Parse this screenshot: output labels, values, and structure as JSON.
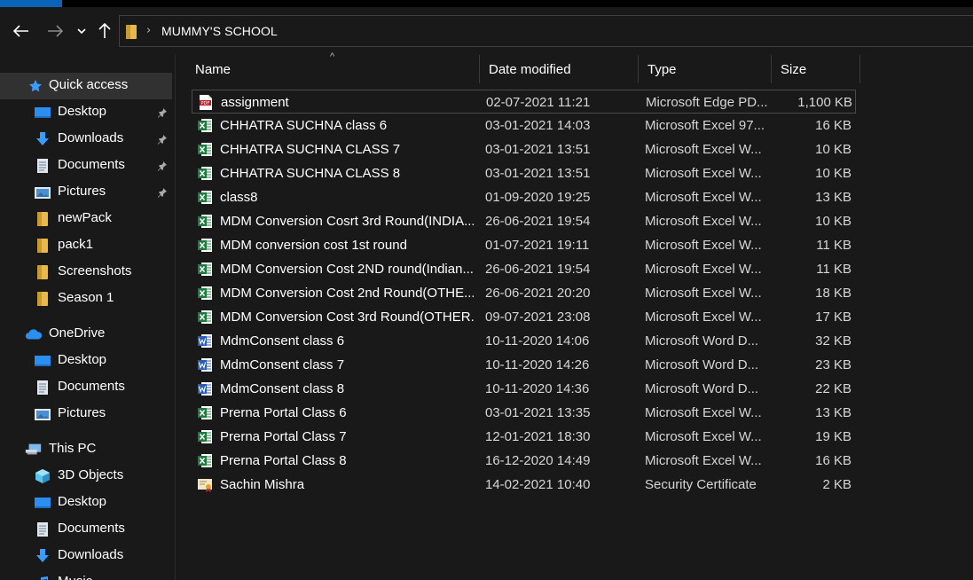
{
  "address": {
    "crumbs": [
      "MUMMY'S SCHOOL"
    ]
  },
  "nav": {
    "back_icon": "arrow-left-icon",
    "forward_icon": "arrow-right-icon",
    "recent_icon": "chevron-down-icon",
    "up_icon": "arrow-up-icon"
  },
  "sidebar": {
    "items": [
      {
        "label": "Quick access",
        "icon": "star-icon",
        "pinned": false,
        "selected": true
      },
      {
        "label": "Desktop",
        "icon": "desktop-icon",
        "pinned": true
      },
      {
        "label": "Downloads",
        "icon": "download-icon",
        "pinned": true
      },
      {
        "label": "Documents",
        "icon": "documents-icon",
        "pinned": true
      },
      {
        "label": "Pictures",
        "icon": "pictures-icon",
        "pinned": true
      },
      {
        "label": "newPack",
        "icon": "folder-icon",
        "pinned": false
      },
      {
        "label": "pack1",
        "icon": "folder-icon",
        "pinned": false
      },
      {
        "label": "Screenshots",
        "icon": "folder-icon",
        "pinned": false
      },
      {
        "label": "Season 1",
        "icon": "folder-icon",
        "pinned": false
      },
      {
        "label": "OneDrive",
        "icon": "cloud-icon",
        "pinned": false
      },
      {
        "label": "Desktop",
        "icon": "desktop-icon",
        "pinned": false
      },
      {
        "label": "Documents",
        "icon": "documents-icon",
        "pinned": false
      },
      {
        "label": "Pictures",
        "icon": "pictures-icon",
        "pinned": false
      },
      {
        "label": "This PC",
        "icon": "computer-icon",
        "pinned": false
      },
      {
        "label": "3D Objects",
        "icon": "cube-icon",
        "pinned": false
      },
      {
        "label": "Desktop",
        "icon": "desktop-icon",
        "pinned": false
      },
      {
        "label": "Documents",
        "icon": "documents-icon",
        "pinned": false
      },
      {
        "label": "Downloads",
        "icon": "download-icon",
        "pinned": false
      },
      {
        "label": "Music",
        "icon": "music-icon",
        "pinned": false
      }
    ]
  },
  "columns": {
    "name": "Name",
    "date": "Date modified",
    "type": "Type",
    "size": "Size"
  },
  "files": [
    {
      "name": "assignment",
      "date": "02-07-2021 11:21",
      "type": "Microsoft Edge PD...",
      "size": "1,100 KB",
      "icon": "pdf-icon"
    },
    {
      "name": "CHHATRA SUCHNA class 6",
      "date": "03-01-2021 14:03",
      "type": "Microsoft Excel 97...",
      "size": "16 KB",
      "icon": "excel-icon"
    },
    {
      "name": "CHHATRA SUCHNA CLASS 7",
      "date": "03-01-2021 13:51",
      "type": "Microsoft Excel W...",
      "size": "10 KB",
      "icon": "excel-icon"
    },
    {
      "name": "CHHATRA SUCHNA CLASS 8",
      "date": "03-01-2021 13:51",
      "type": "Microsoft Excel W...",
      "size": "10 KB",
      "icon": "excel-icon"
    },
    {
      "name": "class8",
      "date": "01-09-2020 19:25",
      "type": "Microsoft Excel W...",
      "size": "13 KB",
      "icon": "excel-icon"
    },
    {
      "name": "MDM Conversion Cosrt 3rd Round(INDIA...",
      "date": "26-06-2021 19:54",
      "type": "Microsoft Excel W...",
      "size": "10 KB",
      "icon": "excel-icon"
    },
    {
      "name": "MDM conversion cost 1st round",
      "date": "01-07-2021 19:11",
      "type": "Microsoft Excel W...",
      "size": "11 KB",
      "icon": "excel-icon"
    },
    {
      "name": "MDM Conversion Cost 2ND round(Indian...",
      "date": "26-06-2021 19:54",
      "type": "Microsoft Excel W...",
      "size": "11 KB",
      "icon": "excel-icon"
    },
    {
      "name": "MDM Conversion Cost 2nd Round(OTHE...",
      "date": "26-06-2021 20:20",
      "type": "Microsoft Excel W...",
      "size": "18 KB",
      "icon": "excel-icon"
    },
    {
      "name": "MDM Conversion Cost 3rd Round(OTHER...",
      "date": "09-07-2021 23:08",
      "type": "Microsoft Excel W...",
      "size": "17 KB",
      "icon": "excel-icon"
    },
    {
      "name": "MdmConsent class 6",
      "date": "10-11-2020 14:06",
      "type": "Microsoft Word D...",
      "size": "32 KB",
      "icon": "word-icon"
    },
    {
      "name": "MdmConsent class 7",
      "date": "10-11-2020 14:26",
      "type": "Microsoft Word D...",
      "size": "23 KB",
      "icon": "word-icon"
    },
    {
      "name": "MdmConsent class 8",
      "date": "10-11-2020 14:36",
      "type": "Microsoft Word D...",
      "size": "22 KB",
      "icon": "word-icon"
    },
    {
      "name": "Prerna Portal Class 6",
      "date": "03-01-2021 13:35",
      "type": "Microsoft Excel W...",
      "size": "13 KB",
      "icon": "excel-icon"
    },
    {
      "name": "Prerna Portal Class 7",
      "date": "12-01-2021 18:30",
      "type": "Microsoft Excel W...",
      "size": "19 KB",
      "icon": "excel-icon"
    },
    {
      "name": "Prerna Portal Class 8",
      "date": "16-12-2020 14:49",
      "type": "Microsoft Excel W...",
      "size": "16 KB",
      "icon": "excel-icon"
    },
    {
      "name": "Sachin Mishra",
      "date": "14-02-2021 10:40",
      "type": "Security Certificate",
      "size": "2 KB",
      "icon": "certificate-icon"
    }
  ],
  "colors": {
    "background": "#191919",
    "accent": "#0a64b8",
    "selected": "#313131",
    "excel": "#1f7a3f",
    "word": "#2b5cb3",
    "pdf": "#c4202a",
    "folder": "#e8b84a"
  }
}
